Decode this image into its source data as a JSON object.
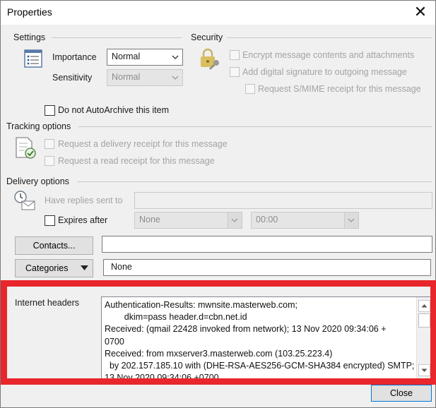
{
  "window": {
    "title": "Properties",
    "close_glyph": "✕"
  },
  "settings": {
    "heading": "Settings",
    "importance_label": "Importance",
    "importance_value": "Normal",
    "sensitivity_label": "Sensitivity",
    "sensitivity_value": "Normal",
    "do_not_autoarchive_label": "Do not AutoArchive this item",
    "do_not_autoarchive_checked": false
  },
  "security": {
    "heading": "Security",
    "encrypt_label": "Encrypt message contents and attachments",
    "signature_label": "Add digital signature to outgoing message",
    "smime_label": "Request S/MIME receipt for this message"
  },
  "tracking": {
    "heading": "Tracking options",
    "delivery_receipt_label": "Request a delivery receipt for this message",
    "read_receipt_label": "Request a read receipt for this message"
  },
  "delivery": {
    "heading": "Delivery options",
    "replies_label": "Have replies sent to",
    "replies_value": "",
    "expires_label": "Expires after",
    "expires_date": "None",
    "expires_time": "00:00"
  },
  "contacts": {
    "button_label": "Contacts...",
    "value": ""
  },
  "categories": {
    "button_label": "Categories",
    "value": "None"
  },
  "internet_headers": {
    "label": "Internet headers",
    "text": "Authentication-Results: mwnsite.masterweb.com;\n        dkim=pass header.d=cbn.net.id\nReceived: (qmail 22428 invoked from network); 13 Nov 2020 09:34:06 +\n0700\nReceived: from mxserver3.masterweb.com (103.25.223.4)\n  by 202.157.185.10 with (DHE-RSA-AES256-GCM-SHA384 encrypted) SMTP;\n13 Nov 2020 09:34:06 +0700"
  },
  "footer": {
    "close_label": "Close"
  },
  "colors": {
    "highlight_frame": "#e8262b",
    "dialog_bg": "#f0f0f0"
  }
}
